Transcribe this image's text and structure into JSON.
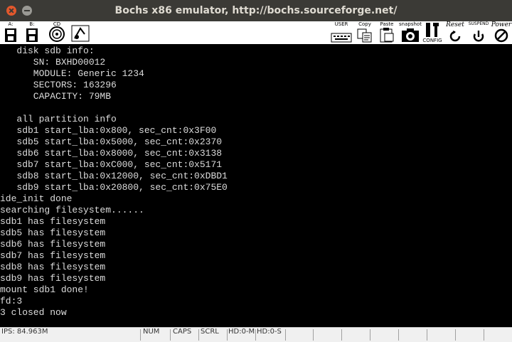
{
  "window": {
    "title": "Bochs x86 emulator, http://bochs.sourceforge.net/"
  },
  "toolbar": {
    "left": [
      {
        "label": "A:",
        "icon": "floppy-a-icon"
      },
      {
        "label": "B:",
        "icon": "floppy-b-icon"
      },
      {
        "label": "CD",
        "icon": "cdrom-icon"
      },
      {
        "label": "",
        "icon": "mouse-icon"
      }
    ],
    "right": [
      {
        "label": "USER",
        "icon": "keyboard-icon"
      },
      {
        "label": "Copy",
        "icon": "copy-icon"
      },
      {
        "label": "Paste",
        "icon": "paste-icon"
      },
      {
        "label": "snapshot",
        "icon": "camera-icon"
      },
      {
        "label": "CONFIG",
        "icon": "config-icon"
      },
      {
        "label": "Reset",
        "icon": "reset-icon"
      },
      {
        "label": "SUSPEND",
        "icon": "suspend-icon"
      },
      {
        "label": "Power",
        "icon": "power-icon"
      }
    ]
  },
  "console": {
    "lines": [
      "   disk sdb info:",
      "      SN: BXHD00012",
      "      MODULE: Generic 1234",
      "      SECTORS: 163296",
      "      CAPACITY: 79MB",
      "",
      "   all partition info",
      "   sdb1 start_lba:0x800, sec_cnt:0x3F00",
      "   sdb5 start_lba:0x5000, sec_cnt:0x2370",
      "   sdb6 start_lba:0x8000, sec_cnt:0x3138",
      "   sdb7 start_lba:0xC000, sec_cnt:0x5171",
      "   sdb8 start_lba:0x12000, sec_cnt:0xDBD1",
      "   sdb9 start_lba:0x20800, sec_cnt:0x75E0",
      "ide_init done",
      "searching filesystem......",
      "sdb1 has filesystem",
      "sdb5 has filesystem",
      "sdb6 has filesystem",
      "sdb7 has filesystem",
      "sdb8 has filesystem",
      "sdb9 has filesystem",
      "mount sdb1 done!",
      "fd:3",
      "3 closed now",
      "_"
    ]
  },
  "statusbar": {
    "ips": "IPS: 84.963M",
    "num": "NUM",
    "caps": "CAPS",
    "scrl": "SCRL",
    "hd0m": "HD:0-M",
    "hd0s": "HD:0-S"
  }
}
